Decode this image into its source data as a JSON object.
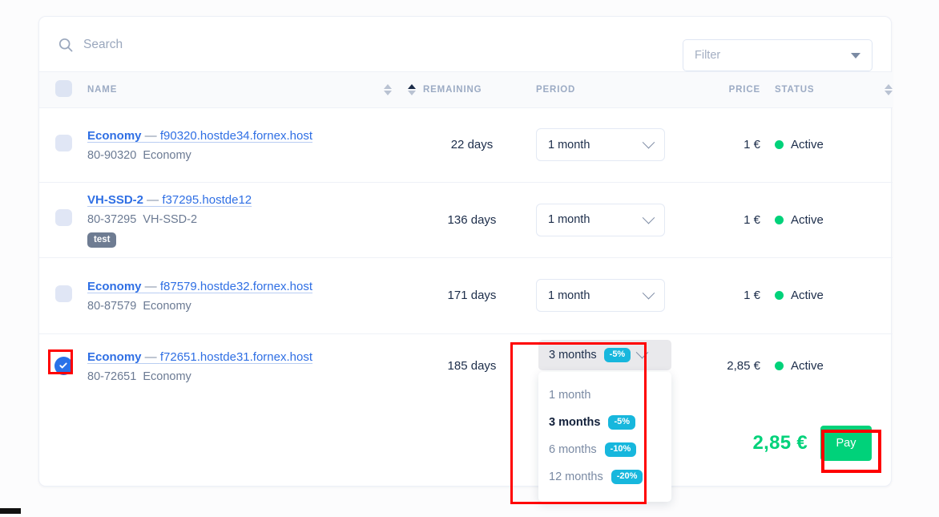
{
  "search": {
    "placeholder": "Search",
    "value": "",
    "icon": "search-icon"
  },
  "filter": {
    "label": "Filter",
    "icon": "caret-down-icon"
  },
  "table": {
    "headers": {
      "name": "NAME",
      "remaining": "REMAINING",
      "period": "PERIOD",
      "price": "PRICE",
      "status": "STATUS"
    },
    "rows": [
      {
        "checked": false,
        "product": "Economy",
        "dash": " — ",
        "host": "f90320.hostde34.fornex.host",
        "sub_id": "80-90320",
        "sub_plan": "Economy",
        "badge": "",
        "remaining": "22 days",
        "period": "1 month",
        "price": "1 €",
        "status": "Active"
      },
      {
        "checked": false,
        "product": "VH-SSD-2",
        "dash": " — ",
        "host": "f37295.hostde12",
        "sub_id": "80-37295",
        "sub_plan": "VH-SSD-2",
        "badge": "test",
        "remaining": "136 days",
        "period": "1 month",
        "price": "1 €",
        "status": "Active"
      },
      {
        "checked": false,
        "product": "Economy",
        "dash": " — ",
        "host": "f87579.hostde32.fornex.host",
        "sub_id": "80-87579",
        "sub_plan": "Economy",
        "badge": "",
        "remaining": "171 days",
        "period": "1 month",
        "price": "1 €",
        "status": "Active"
      },
      {
        "checked": true,
        "product": "Economy",
        "dash": " — ",
        "host": "f72651.hostde31.fornex.host",
        "sub_id": "80-72651",
        "sub_plan": "Economy",
        "badge": "",
        "remaining": "185 days",
        "period": "3 months",
        "period_discount": "-5%",
        "price": "2,85 €",
        "status": "Active"
      }
    ]
  },
  "period_dropdown": {
    "open": true,
    "selected": "3 months",
    "selected_discount": "-5%",
    "options": [
      {
        "label": "1 month",
        "discount": ""
      },
      {
        "label": "3 months",
        "discount": "-5%"
      },
      {
        "label": "6 months",
        "discount": "-10%"
      },
      {
        "label": "12 months",
        "discount": "-20%"
      }
    ]
  },
  "footer": {
    "total": "2,85 €",
    "pay_label": "Pay"
  },
  "colors": {
    "accent_green": "#00d27a",
    "accent_blue": "#2a72e8",
    "badge_cyan": "#17b7dd",
    "annotation_red": "#ff0000",
    "link_blue": "#2f6fe4",
    "text_dark": "#1c2d4a"
  }
}
